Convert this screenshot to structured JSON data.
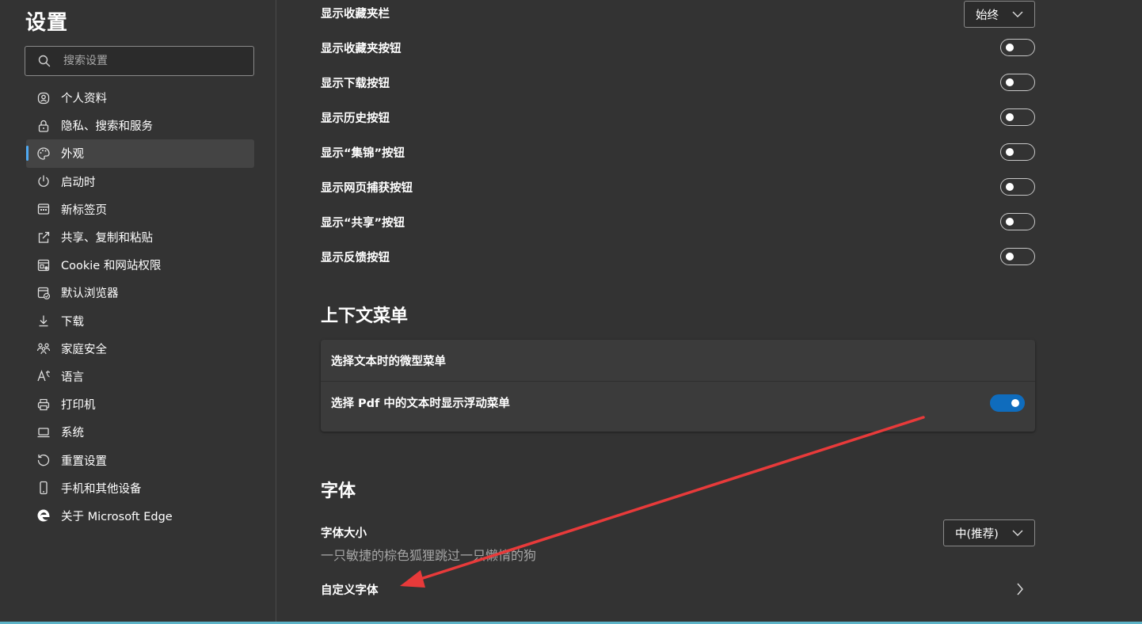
{
  "sidebar": {
    "title": "设置",
    "search_placeholder": "搜索设置",
    "items": [
      {
        "label": "个人资料",
        "icon": "profile-icon"
      },
      {
        "label": "隐私、搜索和服务",
        "icon": "lock-icon"
      },
      {
        "label": "外观",
        "icon": "palette-icon",
        "active": true
      },
      {
        "label": "启动时",
        "icon": "power-icon"
      },
      {
        "label": "新标签页",
        "icon": "new-tab-icon"
      },
      {
        "label": "共享、复制和粘贴",
        "icon": "share-icon"
      },
      {
        "label": "Cookie 和网站权限",
        "icon": "site-permissions-icon"
      },
      {
        "label": "默认浏览器",
        "icon": "default-browser-icon"
      },
      {
        "label": "下载",
        "icon": "download-icon"
      },
      {
        "label": "家庭安全",
        "icon": "family-icon"
      },
      {
        "label": "语言",
        "icon": "language-icon"
      },
      {
        "label": "打印机",
        "icon": "printer-icon"
      },
      {
        "label": "系统",
        "icon": "laptop-icon"
      },
      {
        "label": "重置设置",
        "icon": "reset-icon"
      },
      {
        "label": "手机和其他设备",
        "icon": "phone-icon"
      },
      {
        "label": "关于 Microsoft Edge",
        "icon": "edge-logo-icon"
      }
    ]
  },
  "toolbar_rows": {
    "favorites_bar": {
      "label": "显示收藏夹栏",
      "value": "始终"
    },
    "toggles": [
      {
        "label": "显示收藏夹按钮",
        "on": false
      },
      {
        "label": "显示下载按钮",
        "on": false
      },
      {
        "label": "显示历史按钮",
        "on": false
      },
      {
        "label": "显示“集锦”按钮",
        "on": false
      },
      {
        "label": "显示网页捕获按钮",
        "on": false
      },
      {
        "label": "显示“共享”按钮",
        "on": false
      },
      {
        "label": "显示反馈按钮",
        "on": false
      }
    ]
  },
  "context_menu": {
    "title": "上下文菜单",
    "mini_menu_label": "选择文本时的微型菜单",
    "pdf_menu_label": "选择 Pdf 中的文本时显示浮动菜单",
    "pdf_menu_on": true
  },
  "fonts": {
    "title": "字体",
    "size_label": "字体大小",
    "size_value": "中(推荐)",
    "preview_text": "一只敏捷的棕色狐狸跳过一只懒惰的狗",
    "custom_fonts_label": "自定义字体"
  },
  "colors": {
    "background": "#333333",
    "accent": "#0f6cbd",
    "active_indicator": "#4fa9f2",
    "annotation_arrow": "#e83a3a"
  }
}
